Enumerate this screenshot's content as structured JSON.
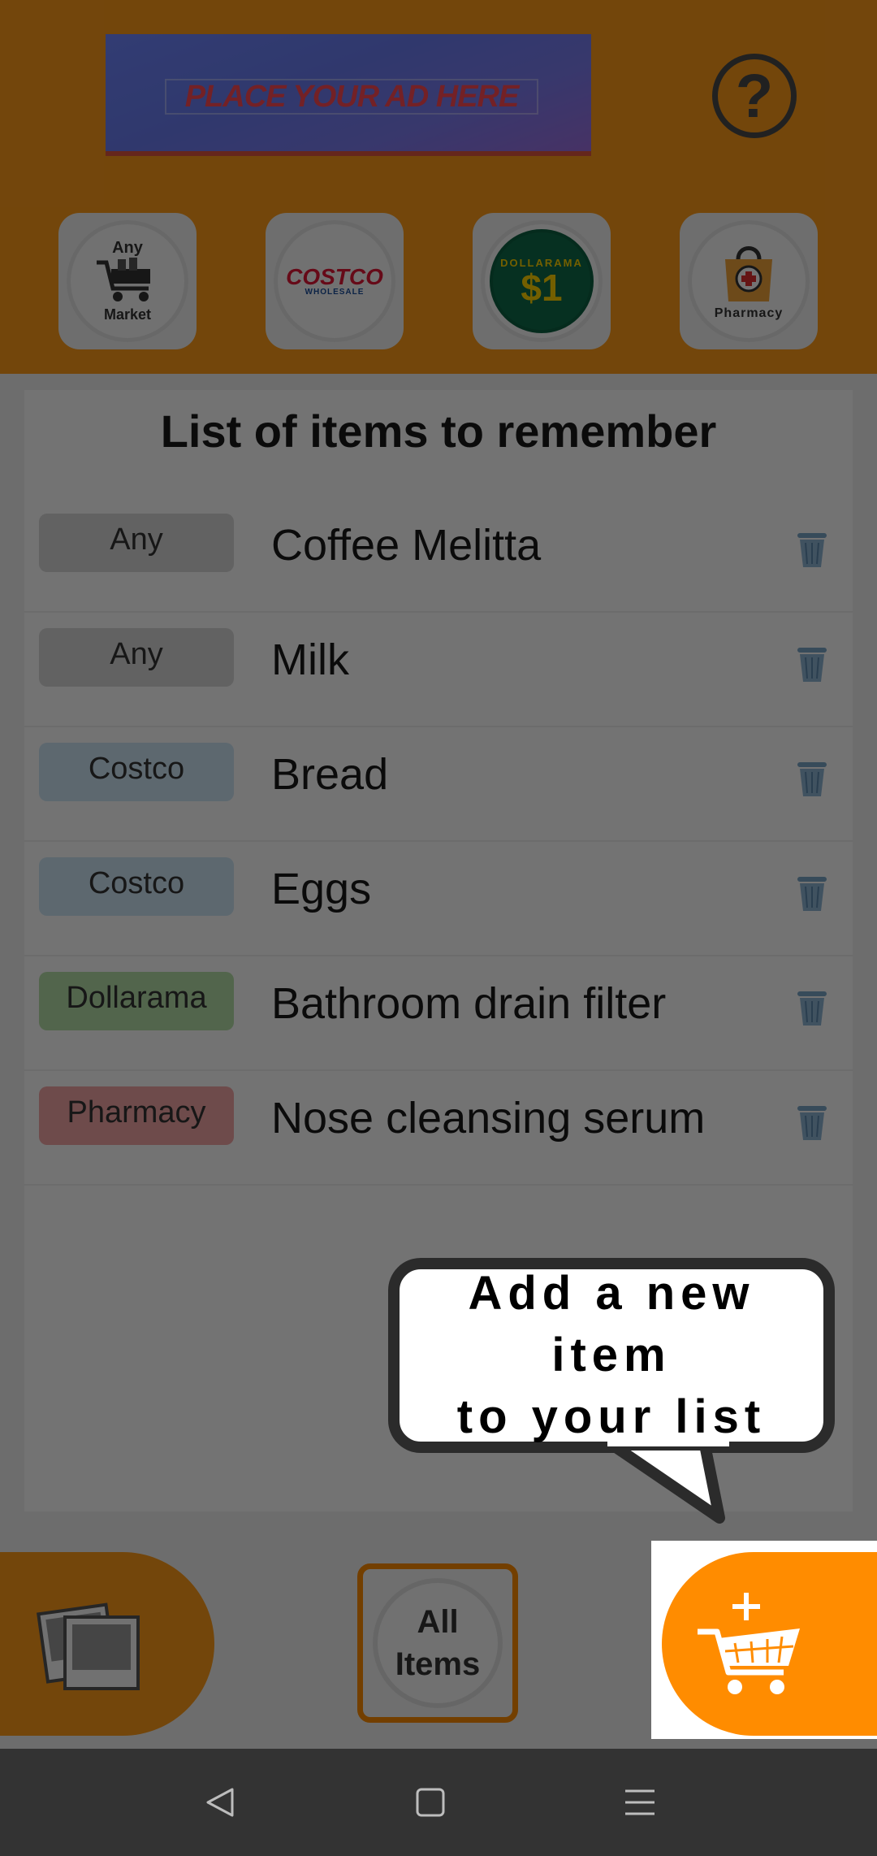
{
  "ad": {
    "text": "PLACE YOUR AD HERE"
  },
  "help": {
    "icon": "question-icon",
    "glyph": "?"
  },
  "stores": [
    {
      "id": "any-market",
      "line1": "Any",
      "line2": "Market"
    },
    {
      "id": "costco",
      "logo": "COSTCO",
      "sub": "WHOLESALE"
    },
    {
      "id": "dollarama",
      "top": "DOLLARAMA",
      "value": "$1"
    },
    {
      "id": "pharmacy",
      "label": "Pharmacy"
    }
  ],
  "list": {
    "title": "List of items to remember",
    "items": [
      {
        "tag": "Any",
        "name": "Coffee Melitta"
      },
      {
        "tag": "Any",
        "name": "Milk"
      },
      {
        "tag": "Costco",
        "name": "Bread"
      },
      {
        "tag": "Costco",
        "name": "Eggs"
      },
      {
        "tag": "Dollarama",
        "name": "Bathroom drain filter"
      },
      {
        "tag": "Pharmacy",
        "name": "Nose cleansing serum"
      }
    ]
  },
  "tooltip": {
    "line1": "Add a new item",
    "line2": "to your list"
  },
  "bottom": {
    "all_items_line1": "All",
    "all_items_line2": "Items"
  },
  "colors": {
    "header": "#ff9b1a",
    "accent": "#ff8c00",
    "tag_any": "#d9d9d9",
    "tag_costco": "#cfe6f7",
    "tag_dollarama": "#b7e0a8",
    "tag_pharmacy": "#f4a6a6"
  }
}
